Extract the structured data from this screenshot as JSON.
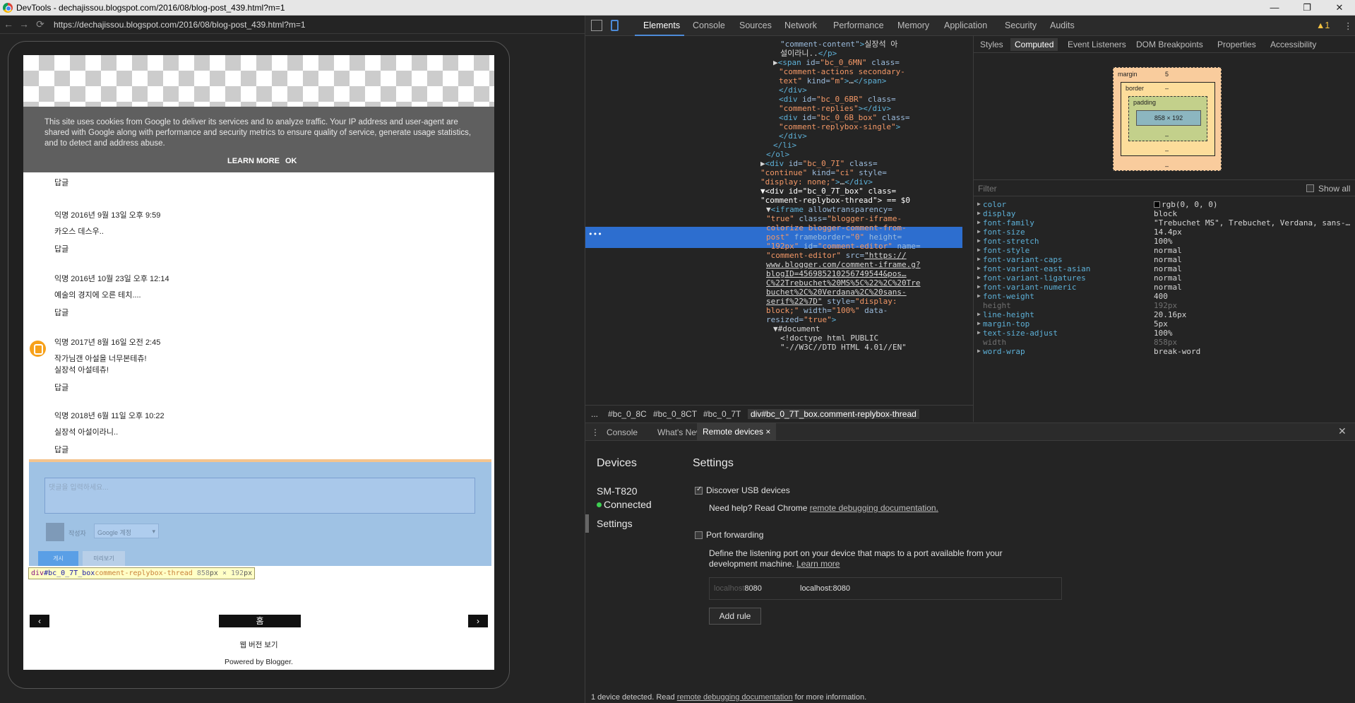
{
  "window": {
    "title": "DevTools - dechajissou.blogspot.com/2016/08/blog-post_439.html?m=1",
    "controls": {
      "minimize": "—",
      "maximize": "❐",
      "close": "✕"
    }
  },
  "browser": {
    "url": "https://dechajissou.blogspot.com/2016/08/blog-post_439.html?m=1",
    "nav": {
      "back": "←",
      "forward": "→",
      "reload": "⟳"
    }
  },
  "page": {
    "cookie_notice": "This site uses cookies from Google to deliver its services and to analyze traffic. Your IP address and user-agent are shared with Google along with performance and security metrics to ensure quality of service, generate usage statistics, and to detect and address abuse.",
    "learn_more": "LEARN MORE",
    "ok": "OK",
    "reply_label": "답글",
    "comments": [
      {
        "meta": "익명 2016년 9월 13일 오후 9:59",
        "body": [
          "카오스 데스우.."
        ]
      },
      {
        "meta": "익명 2016년 10월 23일 오후 12:14",
        "body": [
          "예술의 경지에 오른 테치...."
        ]
      },
      {
        "meta": "익명 2017년 8월 16일 오전 2:45",
        "body": [
          "작가님갠 아설을 너무본테츄!",
          "실장석 아설테츄!"
        ]
      },
      {
        "meta": "익명 2018년 6월 11일 오후 10:22",
        "body": [
          "실장석 아설이라니.."
        ]
      }
    ],
    "comment_placeholder": "댓글을 입력하세요...",
    "comment_as": "작성자",
    "account_select": "Google 계정",
    "publish": "게시",
    "preview": "미리보기",
    "tooltip": {
      "tag": "div",
      "id": "#bc_0_7T_box",
      "cls": "comment-replybox-thread",
      "w": "858",
      "h": "192",
      "px": "px",
      "x": " × "
    },
    "prev_btn": "‹",
    "home_btn": "홈",
    "next_btn": "›",
    "web_version": "웹 버전 보기",
    "powered": "Powered by Blogger."
  },
  "devtools": {
    "tabs": [
      "Elements",
      "Console",
      "Sources",
      "Network",
      "Performance",
      "Memory",
      "Application",
      "Security",
      "Audits"
    ],
    "warnings": "▲1",
    "more": "⋮",
    "breadcrumb": [
      "...",
      "#bc_0_8C",
      "#bc_0_8CT",
      "#bc_0_7T",
      "div#bc_0_7T_box.comment-replybox-thread"
    ],
    "side_tabs": [
      "Styles",
      "Computed",
      "Event Listeners",
      "DOM Breakpoints",
      "Properties",
      "Accessibility"
    ],
    "boxmodel": {
      "margin": "margin",
      "margin_val": "5",
      "border": "border",
      "border_val": "–",
      "padding": "padding",
      "padding_val": "–",
      "content": "858 × 192",
      "dash": "–"
    },
    "filter_placeholder": "Filter",
    "show_all": "Show all",
    "computed": [
      {
        "k": "color",
        "v": "rgb(0, 0, 0)",
        "dim": false,
        "swatch": true
      },
      {
        "k": "display",
        "v": "block",
        "dim": false
      },
      {
        "k": "font-family",
        "v": "\"Trebuchet MS\", Trebuchet, Verdana, sans-…",
        "dim": false
      },
      {
        "k": "font-size",
        "v": "14.4px",
        "dim": false
      },
      {
        "k": "font-stretch",
        "v": "100%",
        "dim": false
      },
      {
        "k": "font-style",
        "v": "normal",
        "dim": false
      },
      {
        "k": "font-variant-caps",
        "v": "normal",
        "dim": false
      },
      {
        "k": "font-variant-east-asian",
        "v": "normal",
        "dim": false
      },
      {
        "k": "font-variant-ligatures",
        "v": "normal",
        "dim": false
      },
      {
        "k": "font-variant-numeric",
        "v": "normal",
        "dim": false
      },
      {
        "k": "font-weight",
        "v": "400",
        "dim": false
      },
      {
        "k": "height",
        "v": "192px",
        "dim": true
      },
      {
        "k": "line-height",
        "v": "20.16px",
        "dim": false
      },
      {
        "k": "margin-top",
        "v": "5px",
        "dim": false
      },
      {
        "k": "text-size-adjust",
        "v": "100%",
        "dim": false
      },
      {
        "k": "width",
        "v": "858px",
        "dim": true
      },
      {
        "k": "word-wrap",
        "v": "break-word",
        "dim": false
      }
    ],
    "elements_lines": [
      {
        "ind": 36,
        "html": "<span class='at'>\"comment-content\"</span><span class='tg'>&gt;</span><span class='tx'>실장석 아</span>"
      },
      {
        "ind": 36,
        "html": "<span class='tx'>설이라니..</span><span class='tg'>&lt;/p&gt;</span>"
      },
      {
        "ind": 26,
        "html": "<span class='tx'>▶</span><span class='tg'>&lt;span </span><span class='at'>id=</span><span class='av'>\"bc_0_6MN\"</span><span class='at'> class=</span>"
      },
      {
        "ind": 34,
        "html": "<span class='av'>\"comment-actions secondary-</span>"
      },
      {
        "ind": 34,
        "html": "<span class='av'>text\"</span><span class='at'> kind=</span><span class='av'>\"m\"</span><span class='tg'>&gt;</span><span class='tx'>…</span><span class='tg'>&lt;/span&gt;</span>"
      },
      {
        "ind": 34,
        "html": "<span class='tg'>&lt;/div&gt;</span>"
      },
      {
        "ind": 34,
        "html": "<span class='tg'>&lt;div </span><span class='at'>id=</span><span class='av'>\"bc_0_6BR\"</span><span class='at'> class=</span>"
      },
      {
        "ind": 34,
        "html": "<span class='av'>\"comment-replies\"</span><span class='tg'>&gt;&lt;/div&gt;</span>"
      },
      {
        "ind": 34,
        "html": "<span class='tg'>&lt;div </span><span class='at'>id=</span><span class='av'>\"bc_0_6B_box\"</span><span class='at'> class=</span>"
      },
      {
        "ind": 34,
        "html": "<span class='av'>\"comment-replybox-single\"</span><span class='tg'>&gt;</span>"
      },
      {
        "ind": 34,
        "html": "<span class='tg'>&lt;/div&gt;</span>"
      },
      {
        "ind": 26,
        "html": "<span class='tg'>&lt;/li&gt;</span>"
      },
      {
        "ind": 16,
        "html": "<span class='tg'>&lt;/ol&gt;</span>"
      },
      {
        "ind": 8,
        "html": "<span class='tx'>▶</span><span class='tg'>&lt;div </span><span class='at'>id=</span><span class='av'>\"bc_0_7I\"</span><span class='at'> class=</span>"
      },
      {
        "ind": 8,
        "html": "<span class='av'>\"continue\"</span><span class='at'> kind=</span><span class='av'>\"ci\"</span><span class='at'> style=</span>"
      },
      {
        "ind": 8,
        "html": "<span class='av'>\"display: none;\"</span><span class='tg'>&gt;</span><span class='tx'>…</span><span class='tg'>&lt;/div&gt;</span>"
      },
      {
        "ind": 8,
        "html": "<span class='tx'>▼</span><span class='tg'>&lt;div </span><span class='at'>id=</span><span class='av'>\"bc_0_7T_box\"</span><span class='at'> class=</span>",
        "sel": true
      },
      {
        "ind": 8,
        "html": "<span class='av'>\"comment-replybox-thread\"</span><span class='tg'>&gt;</span><span class='tx'> == $0</span>",
        "sel": true
      },
      {
        "ind": 16,
        "html": "<span class='tx'>▼</span><span class='tg'>&lt;iframe </span><span class='at'>allowtransparency=</span>"
      },
      {
        "ind": 16,
        "html": "<span class='av'>\"true\"</span><span class='at'> class=</span><span class='av'>\"blogger-iframe-</span>"
      },
      {
        "ind": 16,
        "html": "<span class='av'>colorize blogger-comment-from-</span>"
      },
      {
        "ind": 16,
        "html": "<span class='av'>post\"</span><span class='at'> frameborder=</span><span class='av'>\"0\"</span><span class='at'> height=</span>"
      },
      {
        "ind": 16,
        "html": "<span class='av'>\"192px\"</span><span class='at'> id=</span><span class='av'>\"comment-editor\"</span><span class='at'> name=</span>"
      },
      {
        "ind": 16,
        "html": "<span class='av'>\"comment-editor\"</span><span class='at'> src=</span><span class='ln'>\"https://</span>"
      },
      {
        "ind": 16,
        "html": "<span class='ln'>www.blogger.com/comment-iframe.g?</span>"
      },
      {
        "ind": 16,
        "html": "<span class='ln'>blogID=456985210256749544&amp;pos…</span>"
      },
      {
        "ind": 16,
        "html": "<span class='ln'>C%22Trebuchet%20MS%5C%22%2C%20Tre</span>"
      },
      {
        "ind": 16,
        "html": "<span class='ln'>buchet%2C%20Verdana%2C%20sans-</span>"
      },
      {
        "ind": 16,
        "html": "<span class='ln'>serif%22%7D\"</span><span class='at'> style=</span><span class='av'>\"display:</span>"
      },
      {
        "ind": 16,
        "html": "<span class='av'>block;\"</span><span class='at'> width=</span><span class='av'>\"100%\"</span><span class='at'> data-</span>"
      },
      {
        "ind": 16,
        "html": "<span class='at'>resized=</span><span class='av'>\"true\"</span><span class='tg'>&gt;</span>"
      },
      {
        "ind": 26,
        "html": "<span class='tx'>▼#document</span>"
      },
      {
        "ind": 36,
        "html": "<span class='tx'>&lt;!doctype html PUBLIC</span>"
      },
      {
        "ind": 36,
        "html": "<span class='tx'>\"-//W3C//DTD HTML 4.01//EN\"</span>"
      }
    ],
    "drawer": {
      "tabs": [
        "Console",
        "What's New",
        "Remote devices"
      ],
      "close_tab": "×",
      "close": "✕",
      "devices_heading": "Devices",
      "device_name": "SM-T820",
      "device_status": "Connected",
      "settings_nav": "Settings",
      "settings_heading": "Settings",
      "discover_usb": "Discover USB devices",
      "help_prefix": "Need help? Read Chrome ",
      "help_link": "remote debugging documentation.",
      "port_forwarding": "Port forwarding",
      "pf_desc_1": "Define the listening port on your device that maps to a port available from your",
      "pf_desc_2": "development machine. ",
      "learn_more": "Learn more",
      "pf_device_port_placeholder": "localhost",
      "pf_device_port": "8080",
      "pf_local": "localhost:8080",
      "add_rule": "Add rule",
      "status_prefix": "1 device detected. Read ",
      "status_link": "remote debugging documentation",
      "status_suffix": " for more information."
    }
  }
}
